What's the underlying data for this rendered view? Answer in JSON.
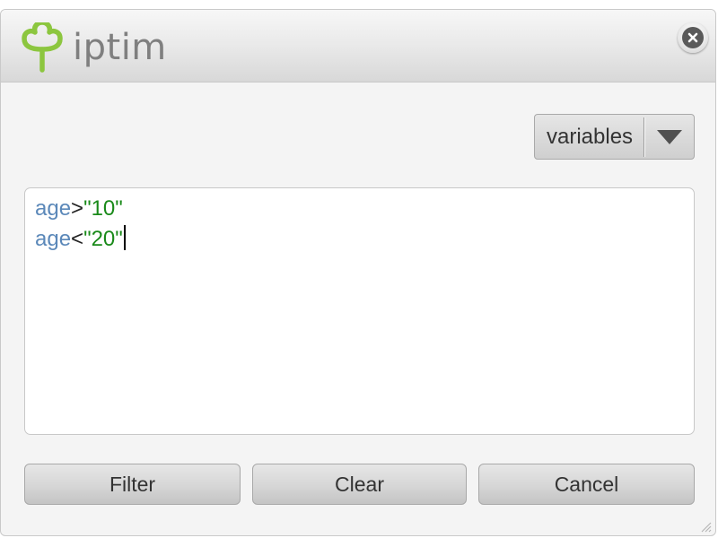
{
  "app": {
    "logo_text": "iptim",
    "logo_color": "#8cc63f"
  },
  "toolbar": {
    "variables_label": "variables"
  },
  "editor": {
    "lines": [
      {
        "var": "age",
        "op": ">",
        "value": "\"10\""
      },
      {
        "var": "age",
        "op": "<",
        "value": "\"20\""
      }
    ]
  },
  "buttons": {
    "filter": "Filter",
    "clear": "Clear",
    "cancel": "Cancel"
  },
  "icons": {
    "logo": "clover-icon",
    "close": "close-icon",
    "dropdown": "chevron-down-icon",
    "resize": "resize-grip-icon"
  },
  "colors": {
    "variable": "#5b88b9",
    "string": "#1a8a1a",
    "operator": "#222222"
  }
}
